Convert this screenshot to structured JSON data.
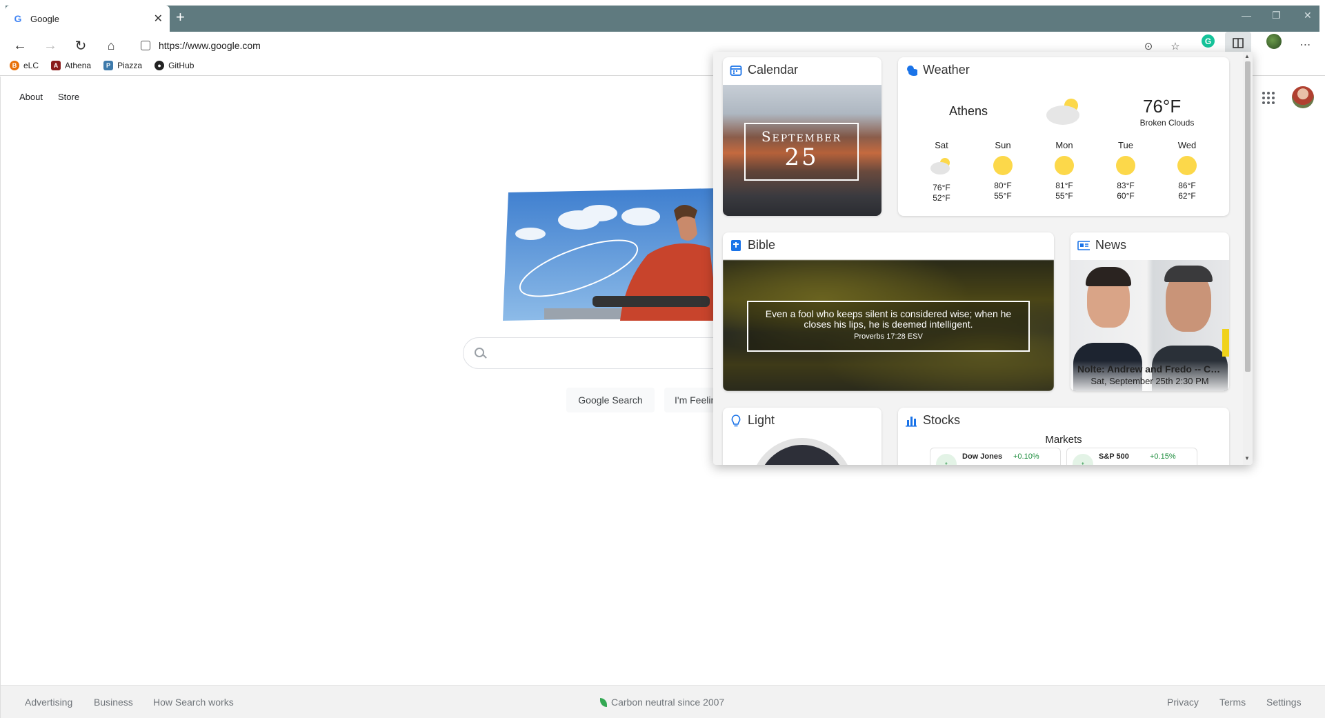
{
  "browser": {
    "tab_title": "Google",
    "url": "https://www.google.com",
    "bookmarks": [
      "eLC",
      "Athena",
      "Piazza",
      "GitHub"
    ]
  },
  "google": {
    "top_links": [
      "About",
      "Store"
    ],
    "buttons": {
      "search": "Google Search",
      "lucky": "I'm Feeling Lucky"
    },
    "footer_left": [
      "Advertising",
      "Business",
      "How Search works"
    ],
    "footer_center": "Carbon neutral since 2007",
    "footer_right": [
      "Privacy",
      "Terms",
      "Settings"
    ]
  },
  "widgets": {
    "calendar": {
      "title": "Calendar",
      "month": "September",
      "day": "25"
    },
    "weather": {
      "title": "Weather",
      "city": "Athens",
      "temp": "76°F",
      "condition": "Broken Clouds",
      "forecast": [
        {
          "day": "Sat",
          "high": "76°F",
          "low": "52°F",
          "icon": "cloud-sun-icon"
        },
        {
          "day": "Sun",
          "high": "80°F",
          "low": "55°F",
          "icon": "sun-icon"
        },
        {
          "day": "Mon",
          "high": "81°F",
          "low": "55°F",
          "icon": "sun-icon"
        },
        {
          "day": "Tue",
          "high": "83°F",
          "low": "60°F",
          "icon": "sun-icon"
        },
        {
          "day": "Wed",
          "high": "86°F",
          "low": "62°F",
          "icon": "sun-icon"
        }
      ]
    },
    "bible": {
      "title": "Bible",
      "verse": "Even a fool who keeps silent is considered wise; when he closes his lips, he is deemed intelligent.",
      "reference": "Proverbs 17:28 ESV"
    },
    "news": {
      "title": "News",
      "headline": "Nolte: Andrew and Fredo -- Cuomo Brothers",
      "time": "Sat, September 25th 2:30 PM"
    },
    "light": {
      "title": "Light"
    },
    "stocks": {
      "title": "Stocks",
      "heading": "Markets",
      "items": [
        {
          "name": "Dow Jones",
          "change": "+0.10%"
        },
        {
          "name": "S&P 500",
          "change": "+0.15%"
        }
      ]
    }
  },
  "colors": {
    "accent": "#1a73e8",
    "chrome": "#5f7a7f",
    "sun": "#fcd84a",
    "positive": "#1e8e3e"
  }
}
